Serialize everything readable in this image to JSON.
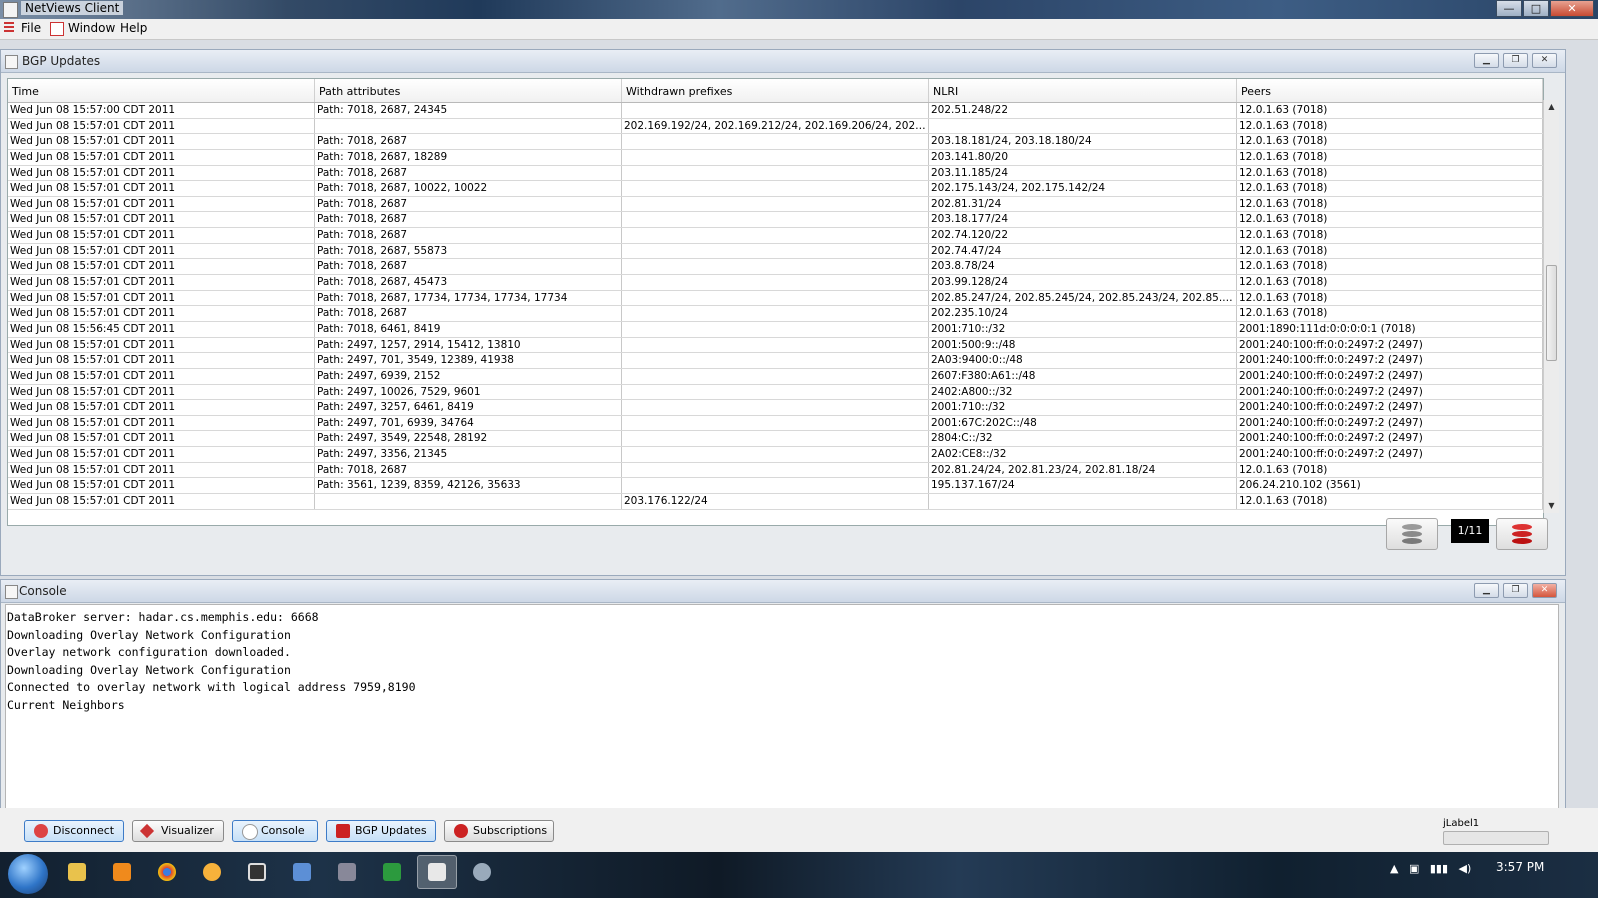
{
  "window": {
    "title": "NetViews Client",
    "minimize_glyph": "—",
    "maximize_glyph": "□",
    "close_glyph": "✕"
  },
  "menu": {
    "items": [
      "File",
      "Window",
      "Help"
    ]
  },
  "bgp_frame": {
    "title": "BGP Updates",
    "columns": [
      "Time",
      "Path attributes",
      "Withdrawn prefixes",
      "NLRI",
      "Peers"
    ],
    "rows": [
      [
        "Wed Jun 08 15:57:00 CDT 2011",
        "Path: 7018, 2687, 24345",
        "",
        "202.51.248/22",
        "12.0.1.63 (7018)"
      ],
      [
        "Wed Jun 08 15:57:01 CDT 2011",
        "",
        "202.169.192/24, 202.169.212/24, 202.169.206/24, 202.169...",
        "",
        "12.0.1.63 (7018)"
      ],
      [
        "Wed Jun 08 15:57:01 CDT 2011",
        "Path: 7018, 2687",
        "",
        "203.18.181/24, 203.18.180/24",
        "12.0.1.63 (7018)"
      ],
      [
        "Wed Jun 08 15:57:01 CDT 2011",
        "Path: 7018, 2687, 18289",
        "",
        "203.141.80/20",
        "12.0.1.63 (7018)"
      ],
      [
        "Wed Jun 08 15:57:01 CDT 2011",
        "Path: 7018, 2687",
        "",
        "203.11.185/24",
        "12.0.1.63 (7018)"
      ],
      [
        "Wed Jun 08 15:57:01 CDT 2011",
        "Path: 7018, 2687, 10022, 10022",
        "",
        "202.175.143/24, 202.175.142/24",
        "12.0.1.63 (7018)"
      ],
      [
        "Wed Jun 08 15:57:01 CDT 2011",
        "Path: 7018, 2687",
        "",
        "202.81.31/24",
        "12.0.1.63 (7018)"
      ],
      [
        "Wed Jun 08 15:57:01 CDT 2011",
        "Path: 7018, 2687",
        "",
        "203.18.177/24",
        "12.0.1.63 (7018)"
      ],
      [
        "Wed Jun 08 15:57:01 CDT 2011",
        "Path: 7018, 2687",
        "",
        "202.74.120/22",
        "12.0.1.63 (7018)"
      ],
      [
        "Wed Jun 08 15:57:01 CDT 2011",
        "Path: 7018, 2687, 55873",
        "",
        "202.74.47/24",
        "12.0.1.63 (7018)"
      ],
      [
        "Wed Jun 08 15:57:01 CDT 2011",
        "Path: 7018, 2687",
        "",
        "203.8.78/24",
        "12.0.1.63 (7018)"
      ],
      [
        "Wed Jun 08 15:57:01 CDT 2011",
        "Path: 7018, 2687, 45473",
        "",
        "203.99.128/24",
        "12.0.1.63 (7018)"
      ],
      [
        "Wed Jun 08 15:57:01 CDT 2011",
        "Path: 7018, 2687, 17734, 17734, 17734, 17734",
        "",
        "202.85.247/24, 202.85.245/24, 202.85.243/24, 202.85.241/...",
        "12.0.1.63 (7018)"
      ],
      [
        "Wed Jun 08 15:57:01 CDT 2011",
        "Path: 7018, 2687",
        "",
        "202.235.10/24",
        "12.0.1.63 (7018)"
      ],
      [
        "Wed Jun 08 15:56:45 CDT 2011",
        "Path: 7018, 6461, 8419",
        "",
        "2001:710::/32",
        "2001:1890:111d:0:0:0:0:1 (7018)"
      ],
      [
        "Wed Jun 08 15:57:01 CDT 2011",
        "Path: 2497, 1257, 2914, 15412, 13810",
        "",
        "2001:500:9::/48",
        "2001:240:100:ff:0:0:2497:2 (2497)"
      ],
      [
        "Wed Jun 08 15:57:01 CDT 2011",
        "Path: 2497, 701, 3549, 12389, 41938",
        "",
        "2A03:9400:0::/48",
        "2001:240:100:ff:0:0:2497:2 (2497)"
      ],
      [
        "Wed Jun 08 15:57:01 CDT 2011",
        "Path: 2497, 6939, 2152",
        "",
        "2607:F380:A61::/48",
        "2001:240:100:ff:0:0:2497:2 (2497)"
      ],
      [
        "Wed Jun 08 15:57:01 CDT 2011",
        "Path: 2497, 10026, 7529, 9601",
        "",
        "2402:A800::/32",
        "2001:240:100:ff:0:0:2497:2 (2497)"
      ],
      [
        "Wed Jun 08 15:57:01 CDT 2011",
        "Path: 2497, 3257, 6461, 8419",
        "",
        "2001:710::/32",
        "2001:240:100:ff:0:0:2497:2 (2497)"
      ],
      [
        "Wed Jun 08 15:57:01 CDT 2011",
        "Path: 2497, 701, 6939, 34764",
        "",
        "2001:67C:202C::/48",
        "2001:240:100:ff:0:0:2497:2 (2497)"
      ],
      [
        "Wed Jun 08 15:57:01 CDT 2011",
        "Path: 2497, 3549, 22548, 28192",
        "",
        "2804:C::/32",
        "2001:240:100:ff:0:0:2497:2 (2497)"
      ],
      [
        "Wed Jun 08 15:57:01 CDT 2011",
        "Path: 2497, 3356, 21345",
        "",
        "2A02:CE8::/32",
        "2001:240:100:ff:0:0:2497:2 (2497)"
      ],
      [
        "Wed Jun 08 15:57:01 CDT 2011",
        "Path: 7018, 2687",
        "",
        "202.81.24/24, 202.81.23/24, 202.81.18/24",
        "12.0.1.63 (7018)"
      ],
      [
        "Wed Jun 08 15:57:01 CDT 2011",
        "Path: 3561, 1239, 8359, 42126, 35633",
        "",
        "195.137.167/24",
        "206.24.210.102 (3561)"
      ],
      [
        "Wed Jun 08 15:57:01 CDT 2011",
        "",
        "203.176.122/24",
        "",
        "12.0.1.63 (7018)"
      ]
    ],
    "page_indicator": "1/11"
  },
  "console_frame": {
    "title": "Console",
    "lines": [
      "DataBroker server: hadar.cs.memphis.edu: 6668",
      "Downloading Overlay Network Configuration",
      "Overlay network configuration downloaded.",
      "Downloading Overlay Network Configuration",
      "Connected to overlay network with logical address 7959,8190",
      "Current Neighbors"
    ]
  },
  "bottom_bar": {
    "buttons": [
      "Disconnect",
      "Visualizer",
      "Console",
      "BGP Updates",
      "Subscriptions"
    ],
    "label": "jLabel1"
  },
  "taskbar": {
    "clock": "3:57 PM"
  },
  "colors": {
    "accent_red": "#cc2222",
    "selection_blue": "#3d7bc7"
  }
}
